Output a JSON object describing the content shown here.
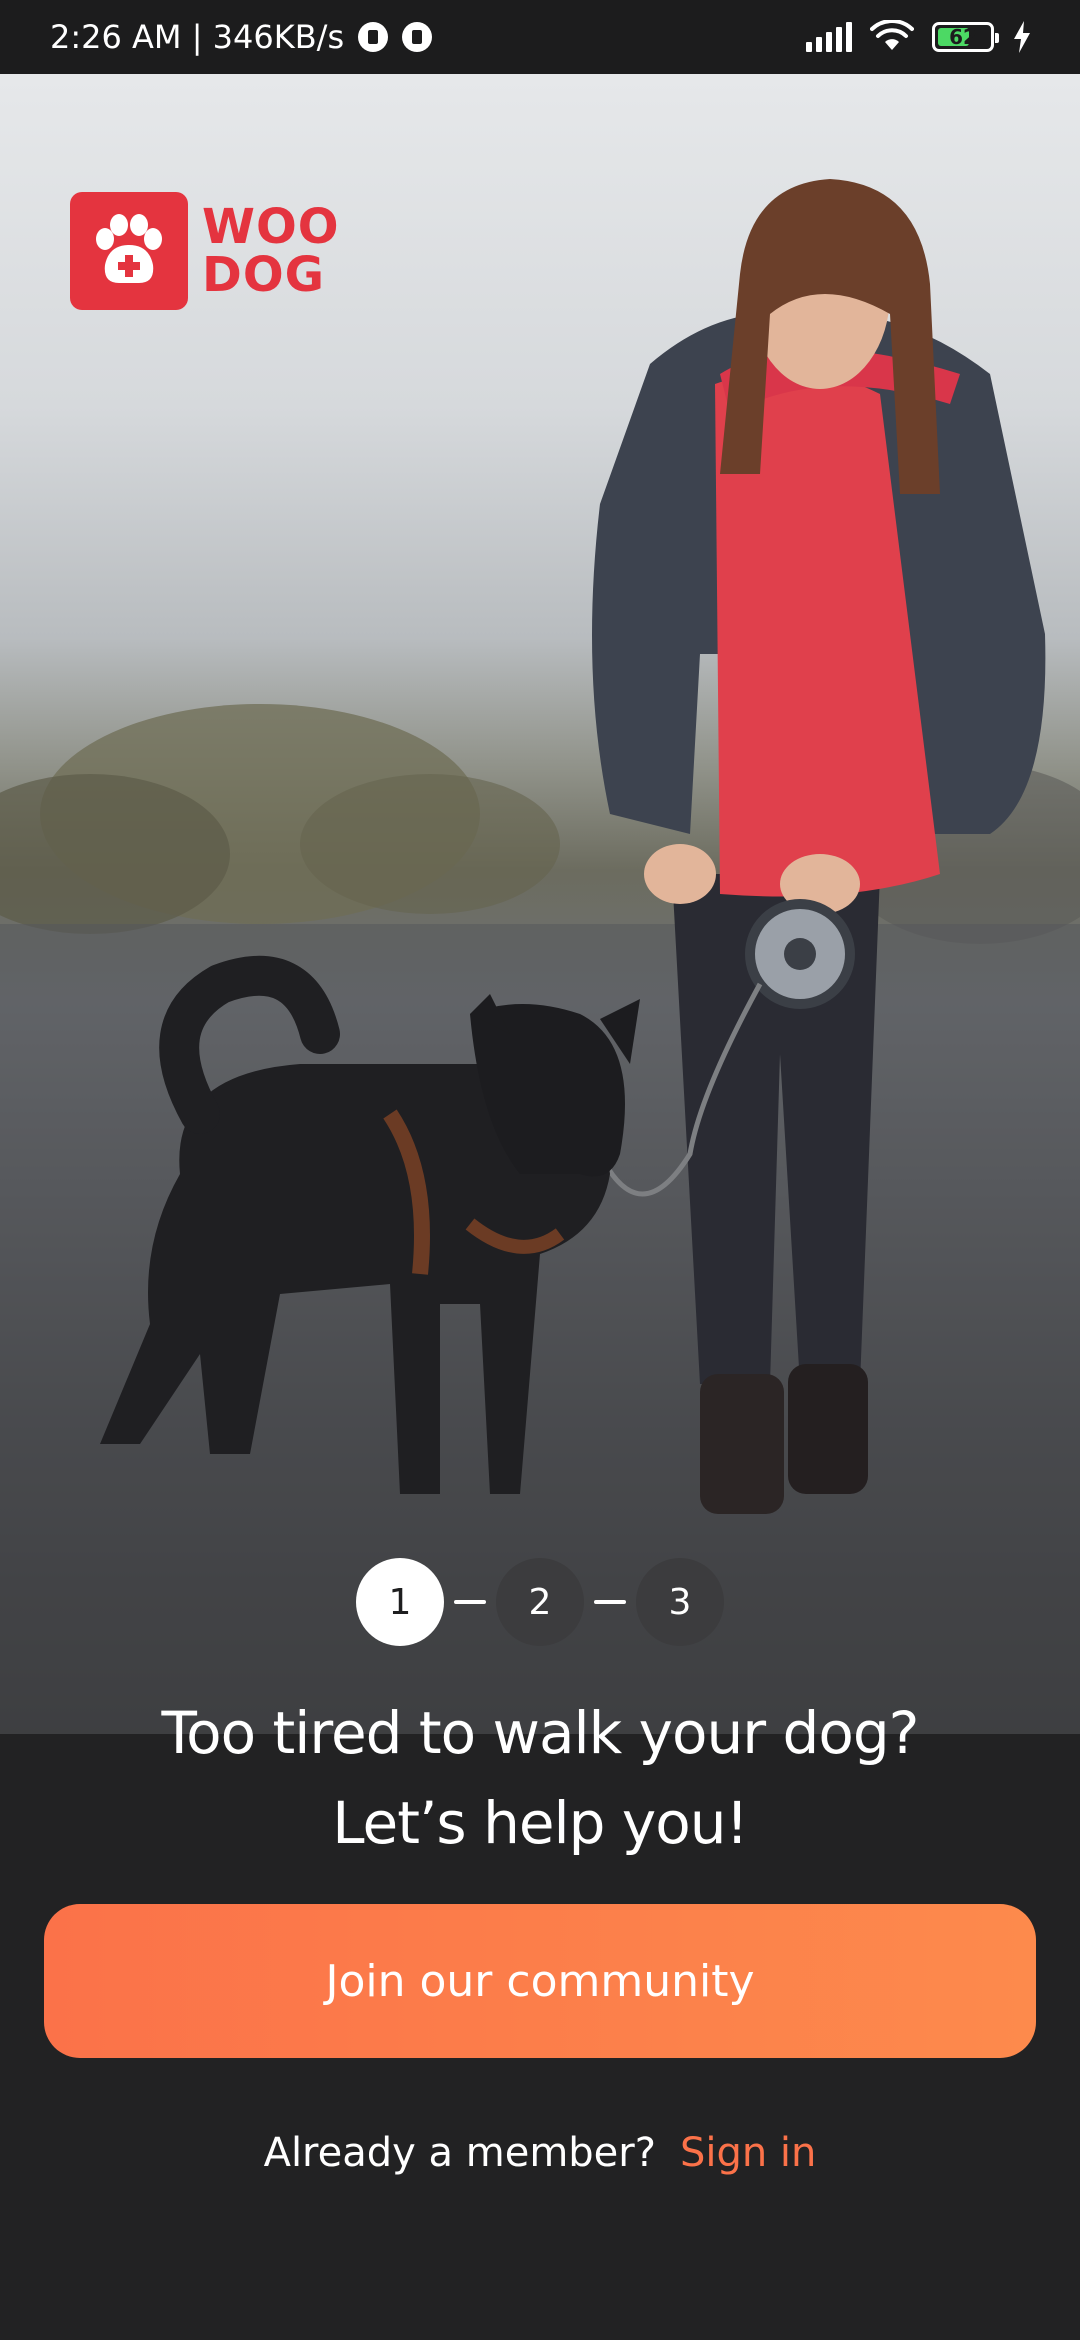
{
  "status_bar": {
    "time_speed": "2:26 AM | 346KB/s",
    "battery_level": "62",
    "battery_fraction": 0.62,
    "icons": [
      "app-notification-icon",
      "app-notification-icon",
      "signal-icon",
      "wifi-icon",
      "battery-icon",
      "charging-icon"
    ]
  },
  "logo": {
    "line1": "WOO",
    "line2": "DOG",
    "color": "#e4343f"
  },
  "onboarding": {
    "steps": [
      "1",
      "2",
      "3"
    ],
    "active_step": 1,
    "headline_line1": "Too tired to walk your dog?",
    "headline_line2": "Let’s help you!"
  },
  "cta": {
    "label": "Join our community",
    "color_start": "#fb7249",
    "color_end": "#fd8a4c"
  },
  "signin": {
    "prompt": "Already a member?",
    "link_label": "Sign in",
    "link_color": "#fb7249"
  },
  "theme": {
    "background": "#222223",
    "battery_green": "#4cd964"
  }
}
